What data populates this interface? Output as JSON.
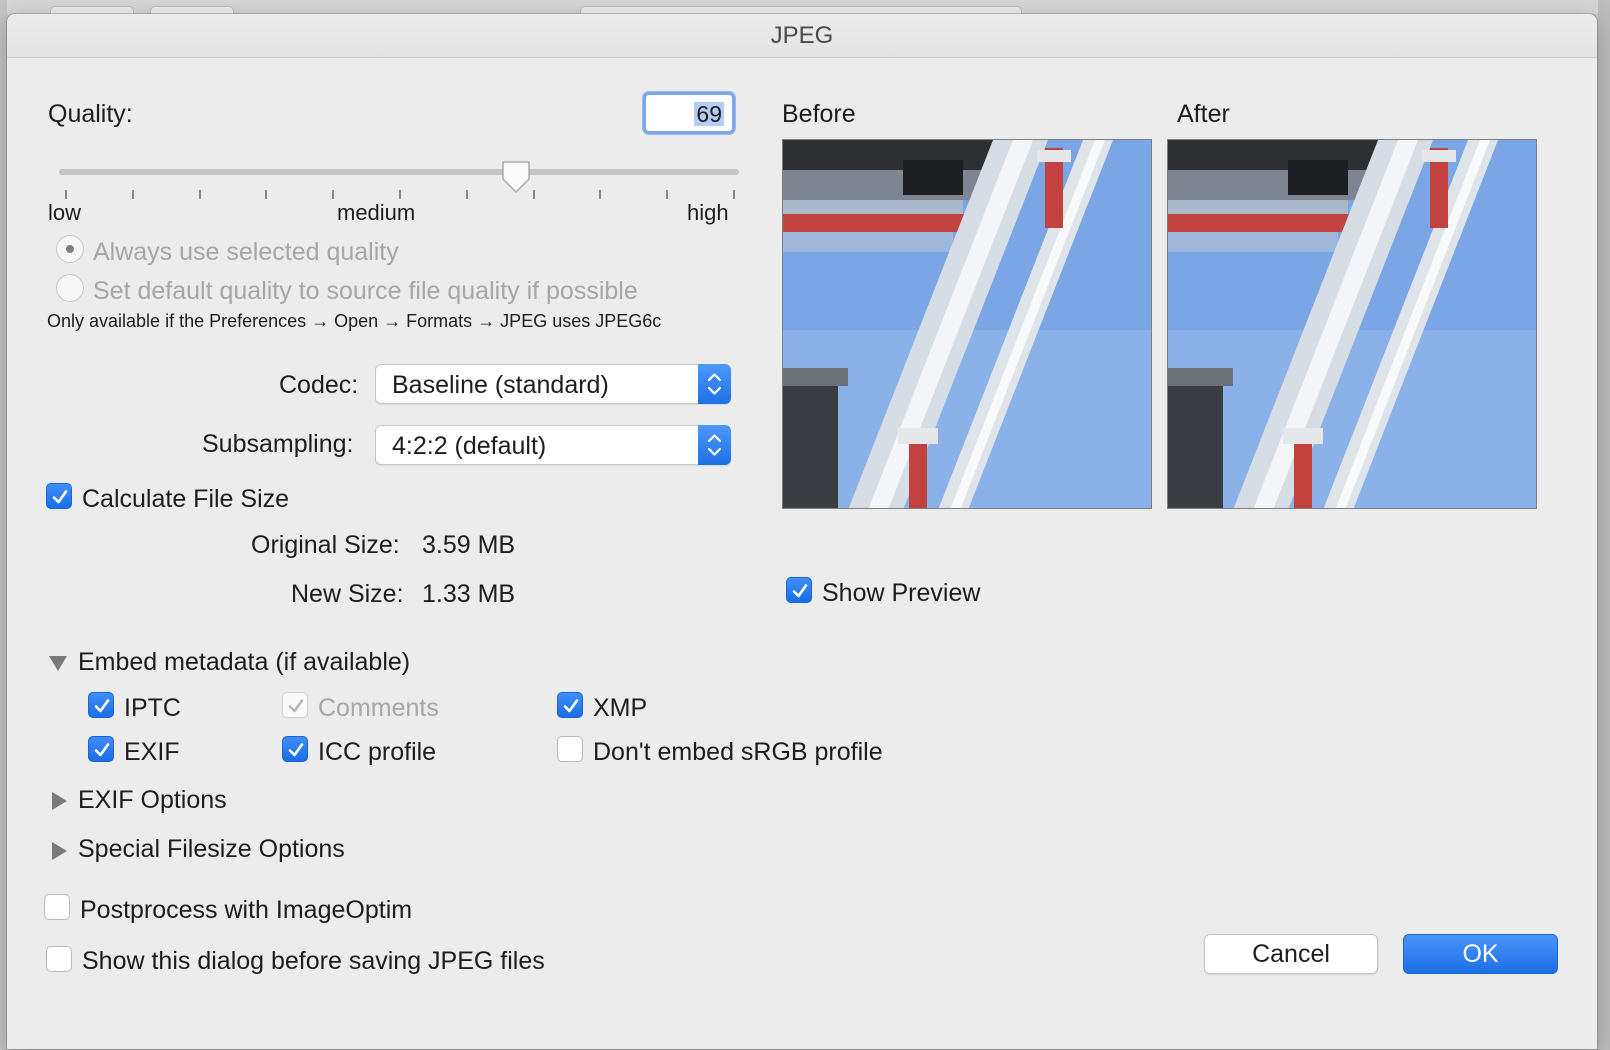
{
  "dialog": {
    "title": "JPEG"
  },
  "quality": {
    "label": "Quality:",
    "value": "69",
    "slider_fraction": 0.675,
    "low_label": "low",
    "medium_label": "medium",
    "high_label": "high"
  },
  "quality_mode": {
    "always_label": "Always use selected quality",
    "source_label": "Set default quality to source file quality if possible",
    "note": "Only available if the Preferences → Open → Formats → JPEG uses JPEG6c"
  },
  "codec": {
    "label": "Codec:",
    "value": "Baseline (standard)"
  },
  "subsampling": {
    "label": "Subsampling:",
    "value": "4:2:2 (default)"
  },
  "file_size": {
    "calc_label": "Calculate File Size",
    "original_label": "Original Size:",
    "original_value": "3.59 MB",
    "new_label": "New Size:",
    "new_value": "1.33 MB"
  },
  "preview": {
    "before_label": "Before",
    "after_label": "After",
    "show_label": "Show Preview"
  },
  "metadata": {
    "section_label": "Embed metadata (if available)",
    "iptc": "IPTC",
    "exif": "EXIF",
    "comments": "Comments",
    "icc": "ICC profile",
    "xmp": "XMP",
    "no_srgb": "Don't embed sRGB profile"
  },
  "sections": {
    "exif_options": "EXIF Options",
    "special_filesize": "Special Filesize Options"
  },
  "options": {
    "postprocess": "Postprocess with ImageOptim",
    "show_dialog": "Show this dialog before saving JPEG files"
  },
  "buttons": {
    "cancel": "Cancel",
    "ok": "OK"
  },
  "colors": {
    "accent": "#1f6fe5",
    "sky": "#7aa6e6",
    "pipe_red": "#c2423f"
  },
  "icons": [
    "radio-icon",
    "checkmark-icon",
    "stepper-arrows-icon",
    "disclosure-triangle-icon",
    "slider-thumb-icon"
  ]
}
